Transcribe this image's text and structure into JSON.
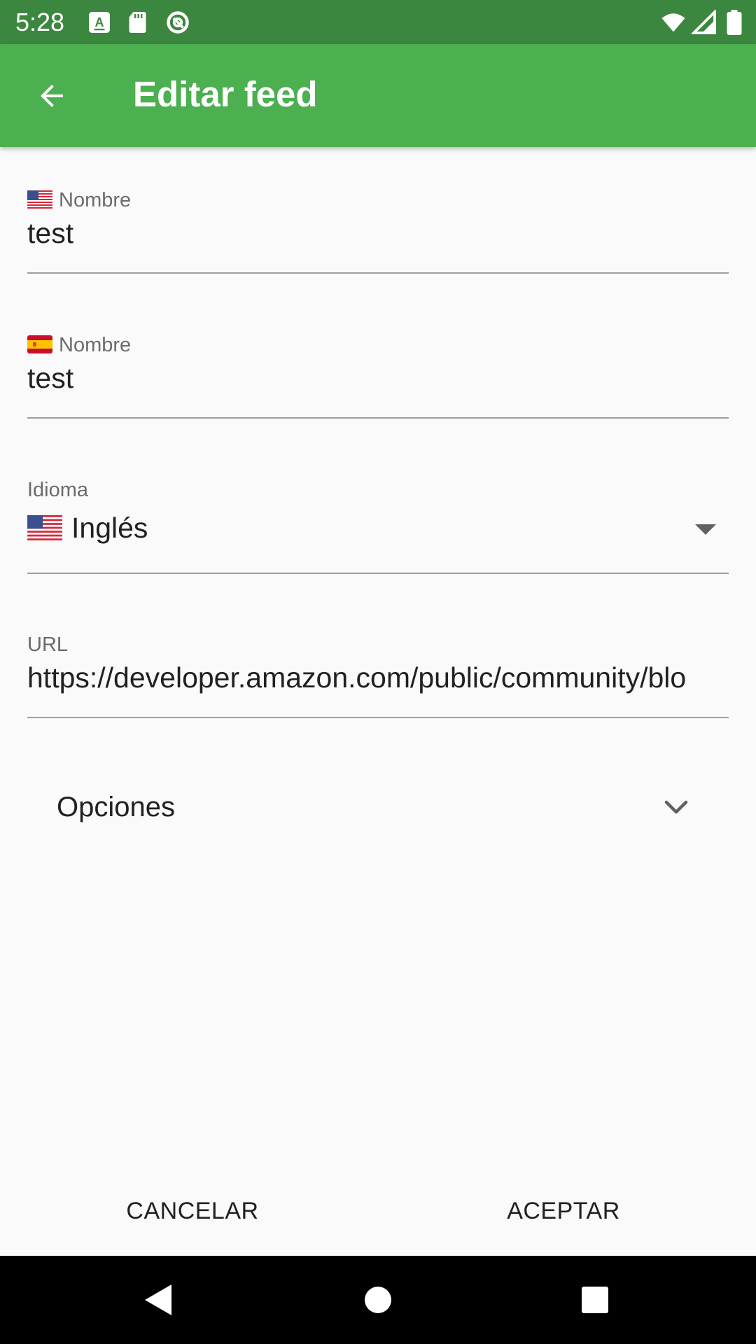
{
  "status_bar": {
    "time": "5:28",
    "icons": [
      "a-notification-icon",
      "sd-card-icon",
      "at-sign-icon",
      "wifi-icon",
      "signal-icon",
      "battery-icon"
    ]
  },
  "app_bar": {
    "title": "Editar feed",
    "back_icon": "arrow-back-icon"
  },
  "fields": {
    "name_en": {
      "label": "Nombre",
      "flag": "us-flag",
      "value": "test"
    },
    "name_es": {
      "label": "Nombre",
      "flag": "es-flag",
      "value": "test"
    },
    "language": {
      "label": "Idioma",
      "flag": "us-flag",
      "value": "Inglés"
    },
    "url": {
      "label": "URL",
      "value": "https://developer.amazon.com/public/community/blo"
    }
  },
  "options": {
    "label": "Opciones",
    "icon": "chevron-down-icon"
  },
  "buttons": {
    "cancel": "CANCELAR",
    "accept": "ACEPTAR"
  },
  "nav_bar": {
    "icons": [
      "back-triangle-icon",
      "home-circle-icon",
      "recents-square-icon"
    ]
  },
  "colors": {
    "status_bar": "#3c873f",
    "app_bar": "#4caf50",
    "background": "#fafafa",
    "nav_bar": "#000000"
  }
}
